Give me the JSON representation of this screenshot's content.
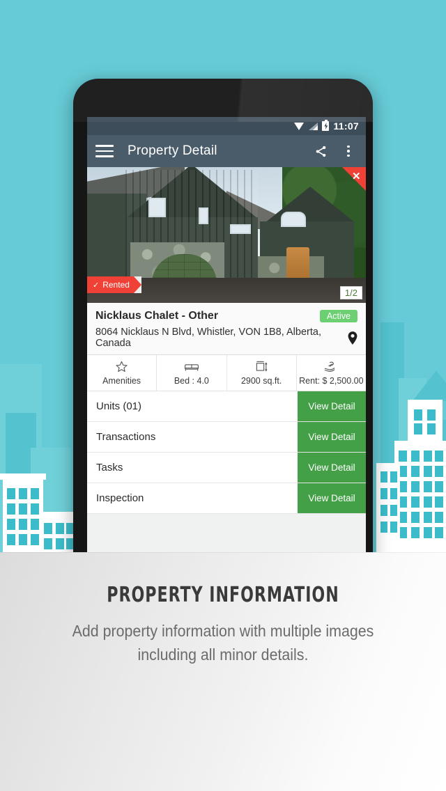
{
  "background": {
    "teal": "#66cbd6",
    "building_window": "#3cbcca"
  },
  "phone": {
    "status_bar": {
      "time": "11:07",
      "icons": [
        "wifi-icon",
        "signal-icon",
        "battery-charging-icon"
      ]
    },
    "toolbar": {
      "menu_icon": "hamburger-menu-icon",
      "title": "Property Detail",
      "share_icon": "share-icon",
      "overflow_icon": "more-vertical-icon"
    },
    "hero": {
      "close_icon": "close-icon",
      "ribbon_label": "Rented",
      "ribbon_check": "✓",
      "ribbon_color": "#ef4136",
      "image_counter": "1/2"
    },
    "property": {
      "name": "Nicklaus Chalet - Other",
      "status_badge": "Active",
      "status_color": "#6ccf72",
      "address": "8064 Nicklaus N Blvd, Whistler, VON 1B8, Alberta, Canada",
      "location_icon": "map-pin-icon"
    },
    "stats": [
      {
        "icon": "star-icon",
        "label": "Amenities"
      },
      {
        "icon": "bed-icon",
        "label": "Bed : 4.0"
      },
      {
        "icon": "area-icon",
        "label": "2900 sq.ft."
      },
      {
        "icon": "money-hand-icon",
        "label": "Rent: $ 2,500.00"
      }
    ],
    "rows": [
      {
        "label": "Units (01)",
        "action": "View Detail"
      },
      {
        "label": "Transactions",
        "action": "View Detail"
      },
      {
        "label": "Tasks",
        "action": "View Detail"
      },
      {
        "label": "Inspection",
        "action": "View Detail"
      }
    ],
    "action_color": "#43a047"
  },
  "caption": {
    "title": "PROPERTY INFORMATION",
    "line1": "Add property information with multiple images",
    "line2": "including all minor details."
  }
}
